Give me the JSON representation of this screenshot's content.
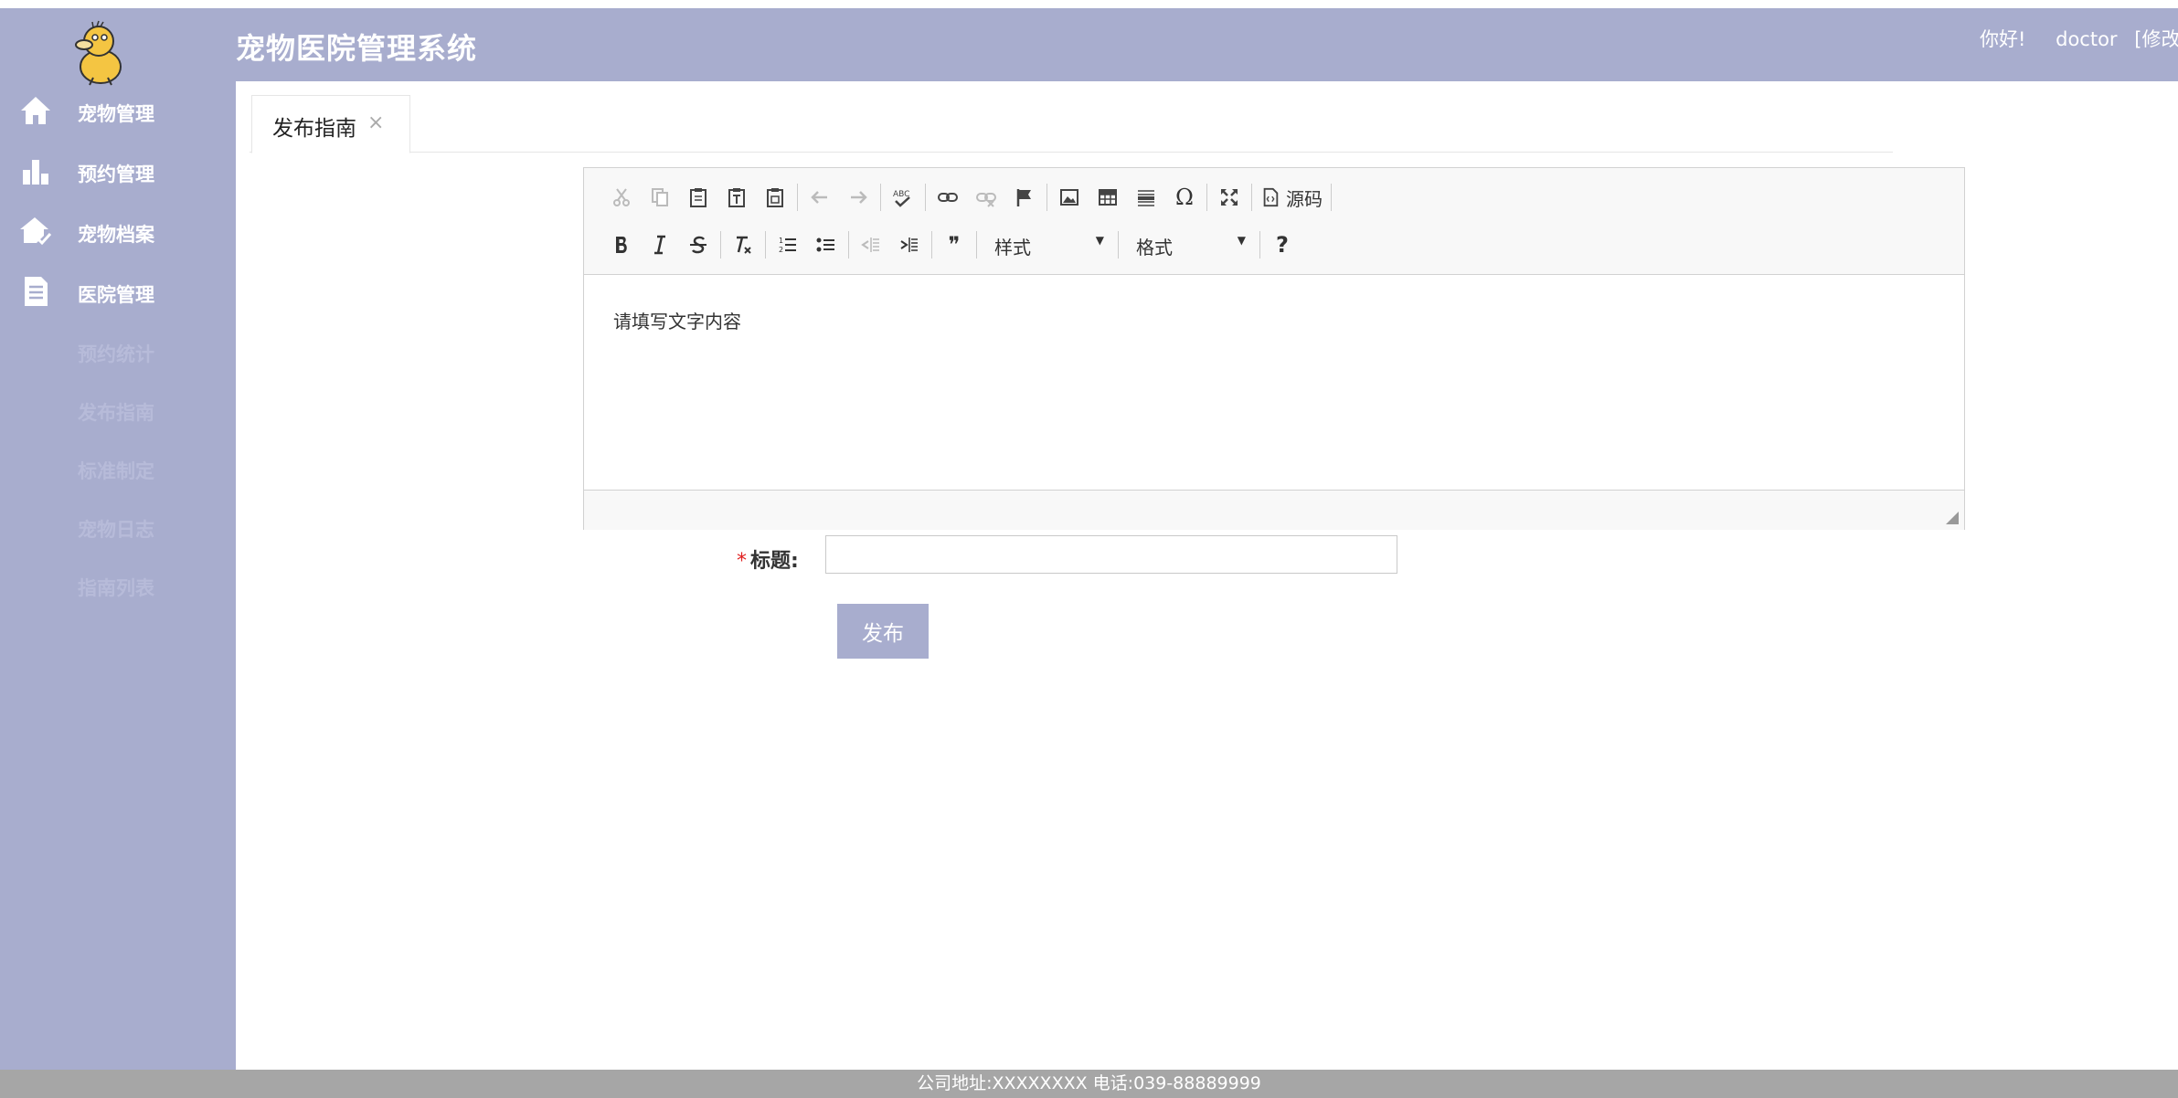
{
  "header": {
    "app_title": "宠物医院管理系统",
    "greeting": "你好!",
    "username": "doctor",
    "change_password": "[修改密"
  },
  "sidebar": {
    "items": [
      {
        "label": "宠物管理",
        "icon": "home-icon"
      },
      {
        "label": "预约管理",
        "icon": "bar-chart-icon"
      },
      {
        "label": "宠物档案",
        "icon": "pet-house-check-icon"
      },
      {
        "label": "医院管理",
        "icon": "document-icon"
      }
    ],
    "subitems": [
      {
        "label": "预约统计"
      },
      {
        "label": "发布指南"
      },
      {
        "label": "标准制定"
      },
      {
        "label": "宠物日志"
      },
      {
        "label": "指南列表"
      }
    ]
  },
  "tabs": [
    {
      "label": "发布指南",
      "close": "×"
    }
  ],
  "editor": {
    "toolbar": {
      "source_label": "源码",
      "style_label": "样式",
      "format_label": "格式",
      "help_label": "?",
      "special_char": "Ω",
      "quote": "❞"
    },
    "content": "请填写文字内容"
  },
  "form": {
    "required_mark": "*",
    "title_label": "标题:",
    "title_value": "",
    "submit_label": "发布"
  },
  "footer": {
    "text": "公司地址:XXXXXXXX 电话:039-88889999"
  },
  "colors": {
    "brand": "#a8adce",
    "footer": "#a6a6a6",
    "required": "#e02020"
  }
}
